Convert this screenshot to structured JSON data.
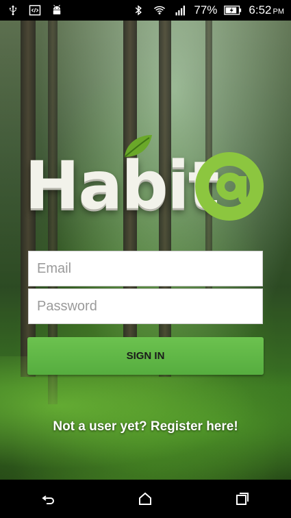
{
  "status_bar": {
    "icons_left": [
      "usb-icon",
      "code-icon",
      "android-icon"
    ],
    "icons_right": [
      "bluetooth-icon",
      "wifi-icon",
      "signal-icon"
    ],
    "battery": "77%",
    "time": "6:52",
    "ampm": "PM"
  },
  "logo": {
    "wordmark": "Habit",
    "symbol": "@"
  },
  "login": {
    "email_placeholder": "Email",
    "password_placeholder": "Password",
    "signin_label": "SIGN IN",
    "register_label": "Not a user yet? Register here!"
  },
  "colors": {
    "accent": "#6cc24f",
    "logo_green": "#8cc63f"
  },
  "nav_bar": {
    "icons": [
      "back-icon",
      "home-icon",
      "recents-icon"
    ]
  }
}
